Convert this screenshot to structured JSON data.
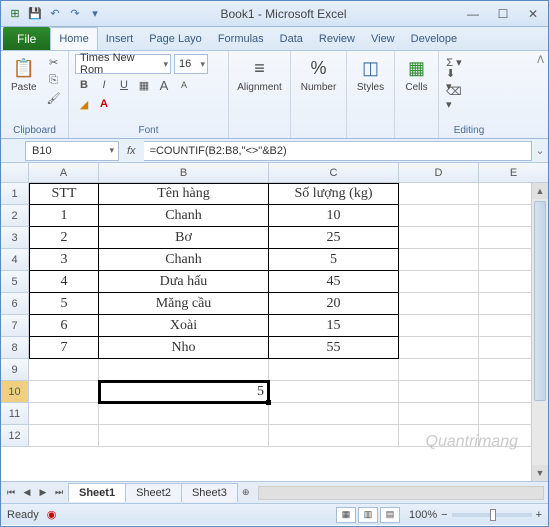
{
  "title": "Book1 - Microsoft Excel",
  "qat": {
    "excel": "⊞",
    "save": "💾",
    "undo": "↶",
    "redo": "↷"
  },
  "tabs": [
    "Home",
    "Insert",
    "Page Layo",
    "Formulas",
    "Data",
    "Review",
    "View",
    "Develope"
  ],
  "file_label": "File",
  "ribbon": {
    "clipboard": {
      "label": "Clipboard",
      "paste": "Paste"
    },
    "font": {
      "label": "Font",
      "name": "Times New Rom",
      "size": "16",
      "bold": "B",
      "italic": "I",
      "underline": "U",
      "grow": "A",
      "shrink": "A"
    },
    "alignment": {
      "label": "Alignment"
    },
    "number": {
      "label": "Number"
    },
    "styles": {
      "label": "Styles"
    },
    "cells": {
      "label": "Cells"
    },
    "editing": {
      "label": "Editing"
    }
  },
  "namebox": "B10",
  "formula": "=COUNTIF(B2:B8,\"<>\"&B2)",
  "cols": {
    "A": 70,
    "B": 170,
    "C": 130,
    "D": 80,
    "E": 70
  },
  "headers": {
    "A": "STT",
    "B": "Tên hàng",
    "C": "Số lượng (kg)"
  },
  "rows": [
    {
      "a": "1",
      "b": "Chanh",
      "c": "10"
    },
    {
      "a": "2",
      "b": "Bơ",
      "c": "25"
    },
    {
      "a": "3",
      "b": "Chanh",
      "c": "5"
    },
    {
      "a": "4",
      "b": "Dưa hấu",
      "c": "45"
    },
    {
      "a": "5",
      "b": "Măng cầu",
      "c": "20"
    },
    {
      "a": "6",
      "b": "Xoài",
      "c": "15"
    },
    {
      "a": "7",
      "b": "Nho",
      "c": "55"
    }
  ],
  "result": "5",
  "sheets": [
    "Sheet1",
    "Sheet2",
    "Sheet3"
  ],
  "status": "Ready",
  "zoom": "100%",
  "watermark": "Quantrimang"
}
